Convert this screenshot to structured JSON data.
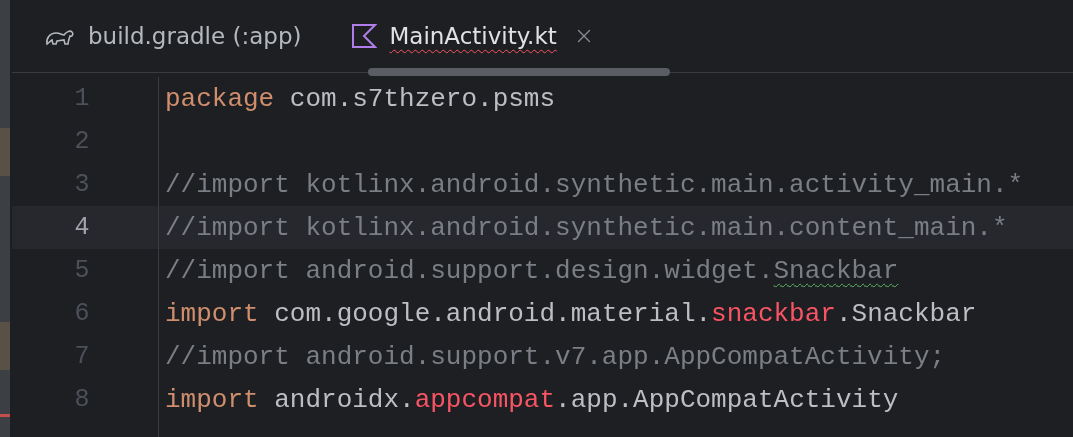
{
  "tabs": [
    {
      "label": "build.gradle (:app)",
      "kind": "gradle",
      "selected": false,
      "has_error": false,
      "closable": false
    },
    {
      "label": "MainActivity.kt",
      "kind": "kotlin",
      "selected": true,
      "has_error": true,
      "closable": true
    }
  ],
  "editor": {
    "lines": [
      {
        "number": "1",
        "current": false,
        "tokens": [
          {
            "text": "package",
            "kind": "keyword"
          },
          {
            "text": " com.s7thzero.psms",
            "kind": "plain"
          }
        ]
      },
      {
        "number": "2",
        "current": false
      },
      {
        "number": "3",
        "current": false,
        "tokens": [
          {
            "text": "//import kotlinx.android.synthetic.main.activity_main.*",
            "kind": "comment"
          }
        ]
      },
      {
        "number": "4",
        "current": true,
        "tokens": [
          {
            "text": "//import kotlinx.android.synthetic.main.content_main.*",
            "kind": "comment"
          }
        ]
      },
      {
        "number": "5",
        "current": false,
        "tokens": [
          {
            "text": "//import android.support.design.widget.",
            "kind": "comment"
          },
          {
            "text": "Snackbar",
            "kind": "warning"
          }
        ]
      },
      {
        "number": "6",
        "current": false,
        "tokens": [
          {
            "text": "import",
            "kind": "keyword"
          },
          {
            "text": " com.google.android.material.",
            "kind": "plain"
          },
          {
            "text": "snackbar",
            "kind": "error"
          },
          {
            "text": ".Snackbar",
            "kind": "plain"
          }
        ]
      },
      {
        "number": "7",
        "current": false,
        "tokens": [
          {
            "text": "//import android.support.v7.app.AppCompatActivity;",
            "kind": "comment"
          }
        ]
      },
      {
        "number": "8",
        "current": false,
        "tokens": [
          {
            "text": "import",
            "kind": "keyword"
          },
          {
            "text": " androidx.",
            "kind": "plain"
          },
          {
            "text": "appcompat",
            "kind": "error"
          },
          {
            "text": ".app.AppCompatActivity",
            "kind": "plain"
          }
        ]
      }
    ]
  }
}
